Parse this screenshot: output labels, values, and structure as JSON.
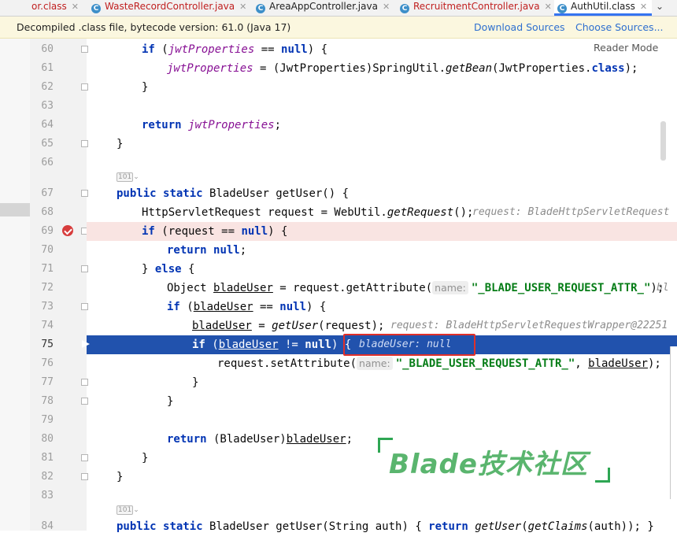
{
  "tabs": [
    {
      "label": "or.class",
      "active": false,
      "icon": "class-icon",
      "has_close": true
    },
    {
      "label": "WasteRecordController.java",
      "active": false,
      "icon": "class-icon"
    },
    {
      "label": "AreaAppController.java",
      "active": false,
      "icon": "class-icon"
    },
    {
      "label": "RecruitmentController.java",
      "active": false,
      "icon": "class-icon"
    },
    {
      "label": "AuthUtil.class",
      "active": true,
      "icon": "class-icon"
    }
  ],
  "banner": {
    "text": "Decompiled .class file, bytecode version: 61.0 (Java 17)",
    "download_sources": "Download Sources",
    "choose_sources": "Choose Sources..."
  },
  "editor": {
    "reader_mode": "Reader Mode",
    "line_numbers": [
      "60",
      "61",
      "62",
      "63",
      "64",
      "65",
      "66",
      "67",
      "68",
      "69",
      "70",
      "71",
      "72",
      "73",
      "74",
      "75",
      "76",
      "77",
      "78",
      "79",
      "80",
      "81",
      "82",
      "83",
      "84"
    ],
    "code": {
      "l60": {
        "a": "if",
        "b": " (",
        "c": "jwtProperties",
        "d": " == ",
        "e": "null",
        "f": ") {"
      },
      "l61": {
        "a": "jwtProperties",
        "b": " = (JwtProperties)SpringUtil.",
        "c": "getBean",
        "d": "(JwtProperties.",
        "e": "class",
        "f": ");"
      },
      "l62": {
        "a": "}"
      },
      "l64": {
        "a": "return",
        "b": " ",
        "c": "jwtProperties",
        "d": ";"
      },
      "l65": {
        "a": "}"
      },
      "l67": {
        "a": "public",
        "b": " ",
        "c": "static",
        "d": " BladeUser getUser() {"
      },
      "l68": {
        "a": "HttpServletRequest request = WebUtil.",
        "b": "getRequest",
        "c": "();",
        "d": "request: BladeHttpServletRequest"
      },
      "l69": {
        "a": "if",
        "b": " (request == ",
        "c": "null",
        "d": ") {"
      },
      "l70": {
        "a": "return",
        "b": " ",
        "c": "null",
        "d": ";"
      },
      "l71": {
        "a": "} ",
        "b": "else",
        "c": " {"
      },
      "l72": {
        "a": "Object ",
        "b": "bladeUser",
        "c": " = request.getAttribute(",
        "d": "name:",
        "e": "\"_BLADE_USER_REQUEST_ATTR_\"",
        "f": ");",
        "g": "bl"
      },
      "l73": {
        "a": "if",
        "b": " (",
        "c": "bladeUser",
        "d": " == ",
        "e": "null",
        "f": ") {"
      },
      "l74": {
        "a": "bladeUser",
        "b": " = ",
        "c": "getUser",
        "d": "(request);",
        "e": "request: BladeHttpServletRequestWrapper@22251"
      },
      "l75": {
        "a": "if",
        "b": " (",
        "c": "bladeUser",
        "d": " != ",
        "e": "null",
        "f": ") {",
        "g": "bladeUser: null"
      },
      "l76": {
        "a": "request.setAttribute(",
        "b": "name:",
        "c": "\"_BLADE_USER_REQUEST_ATTR_\"",
        "d": ", ",
        "e": "bladeUser",
        "f": ");"
      },
      "l77": {
        "a": "}"
      },
      "l78": {
        "a": "}"
      },
      "l80": {
        "a": "return",
        "b": " (BladeUser)",
        "c": "bladeUser",
        "d": ";"
      },
      "l81": {
        "a": "}"
      },
      "l82": {
        "a": "}"
      },
      "l84": {
        "a": "public",
        "b": " ",
        "c": "static",
        "d": " BladeUser getUser(String auth) { ",
        "e": "return",
        "f": " ",
        "g": "getUser",
        "h": "(",
        "i": "getClaims",
        "j": "(auth)); }"
      }
    }
  },
  "watermark": {
    "text": "Blade技术社区",
    "color": "#2ea653"
  },
  "colors": {
    "keyword": "#0033b3",
    "field": "#871094",
    "string": "#067d17",
    "exec_line": "#2152ad",
    "breakpoint_line": "#f9e4e2",
    "highlight_box": "#e0302a"
  }
}
